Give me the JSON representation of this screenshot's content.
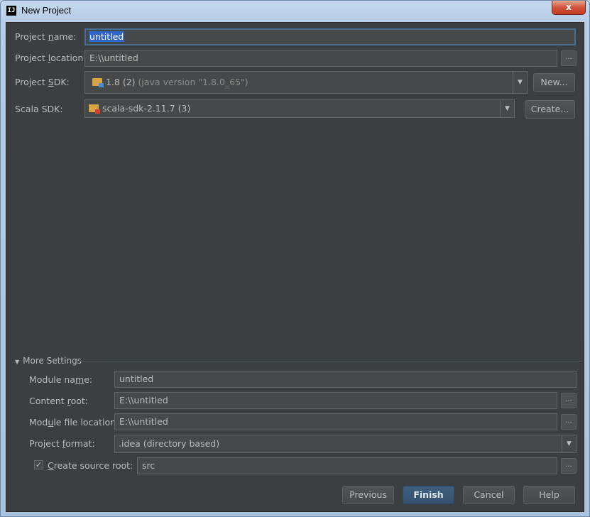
{
  "window": {
    "title": "New Project",
    "app_icon": "IJ",
    "close_symbol": "x"
  },
  "form": {
    "project_name": {
      "label": "Project name:",
      "value": "untitled"
    },
    "project_location": {
      "label": "Project location:",
      "value": "E:\\\\untitled",
      "browse": "..."
    },
    "project_sdk": {
      "label": "Project SDK:",
      "value": "1.8 (2)",
      "detail": "(java version \"1.8.0_65\")",
      "button": "New..."
    },
    "scala_sdk": {
      "label": "Scala SDK:",
      "value": "scala-sdk-2.11.7 (3)",
      "button": "Create..."
    }
  },
  "more_settings": {
    "title": "More Settings",
    "module_name": {
      "label": "Module name:",
      "value": "untitled"
    },
    "content_root": {
      "label": "Content root:",
      "value": "E:\\\\untitled",
      "browse": "..."
    },
    "module_file_location": {
      "label": "Module file location:",
      "value": "E:\\\\untitled",
      "browse": "..."
    },
    "project_format": {
      "label": "Project format:",
      "value": ".idea (directory based)"
    },
    "create_source_root": {
      "label": "Create source root:",
      "checked": true,
      "value": "src",
      "browse": "..."
    }
  },
  "buttons": {
    "previous": "Previous",
    "finish": "Finish",
    "cancel": "Cancel",
    "help": "Help"
  },
  "icons": {
    "dropdown": "chevron-down-icon",
    "folder": "folder-icon",
    "check": "checkmark-icon"
  },
  "colors": {
    "dialog_background": "#3c3f41",
    "field_background": "#45494a",
    "selection": "#2f65ca",
    "default_button": "#3f5f80"
  }
}
